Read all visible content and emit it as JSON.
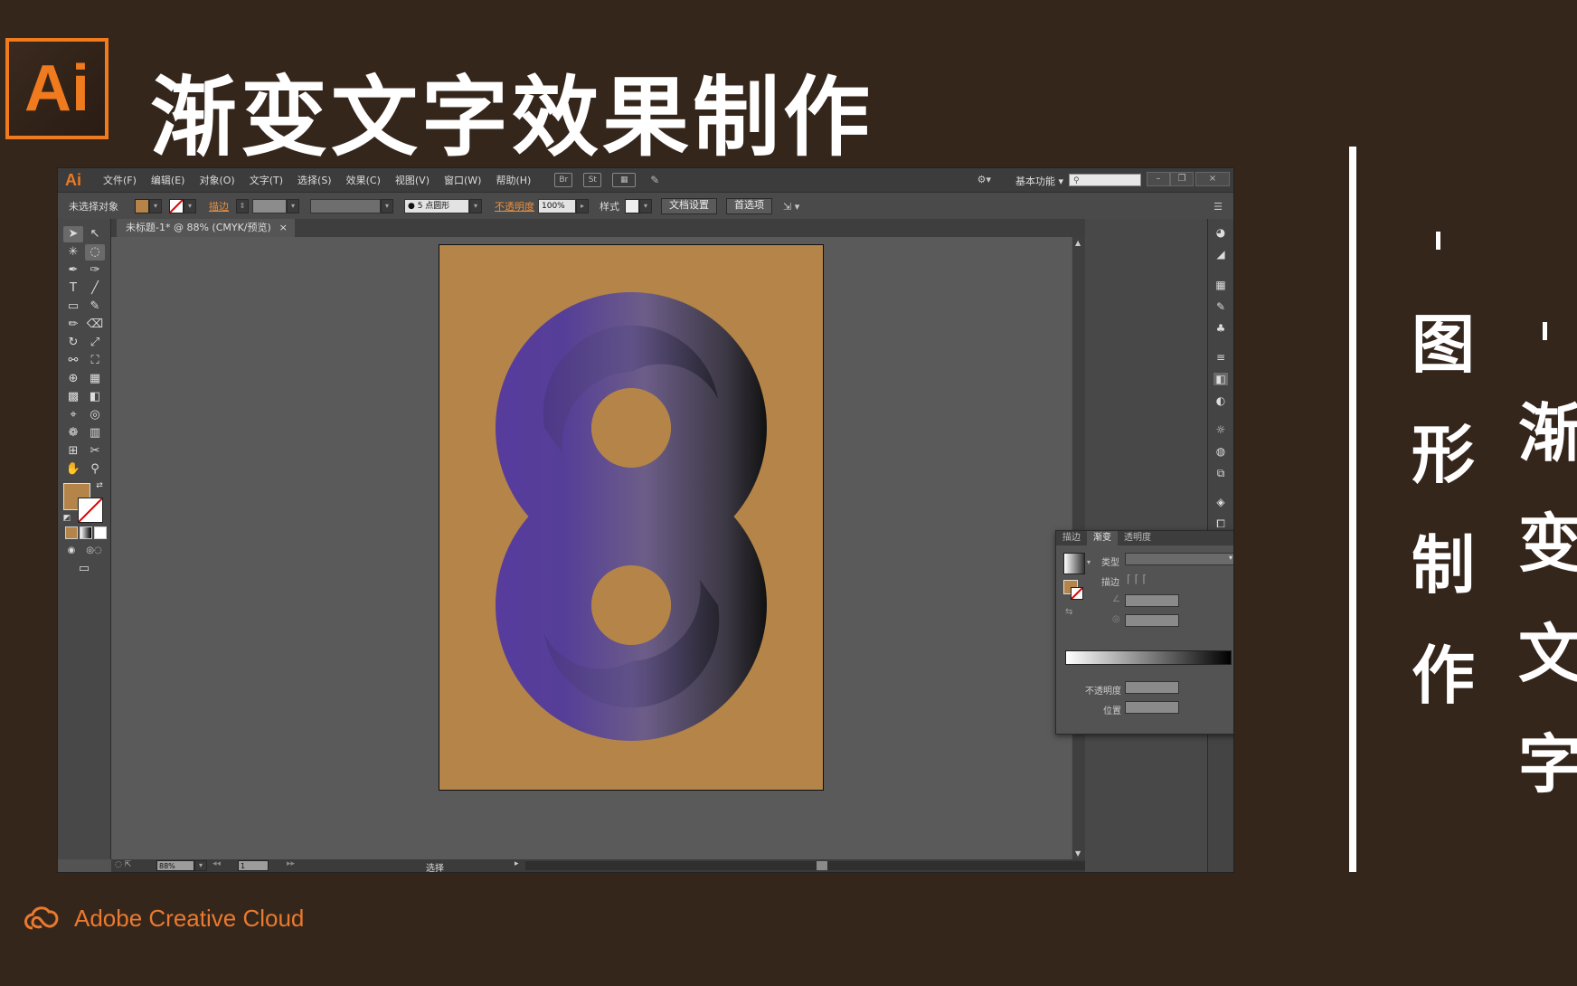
{
  "slide": {
    "logo": "Ai",
    "headline": "渐变文字效果制作",
    "vertical_left": [
      "图",
      "形",
      "制",
      "作"
    ],
    "vertical_right": [
      "渐",
      "变",
      "文",
      "字"
    ],
    "footer_brand": "Adobe Creative Cloud",
    "colors": {
      "background": "#35261c",
      "accent": "#f07a1e"
    }
  },
  "app": {
    "mark": "Ai",
    "menu": [
      "文件(F)",
      "编辑(E)",
      "对象(O)",
      "文字(T)",
      "选择(S)",
      "效果(C)",
      "视图(V)",
      "窗口(W)",
      "帮助(H)"
    ],
    "workspace": "基本功能",
    "menubar_icons": [
      "Br",
      "St"
    ]
  },
  "control_bar": {
    "selection": "未选择对象",
    "stroke_label": "描边",
    "brush": "5 点圆形",
    "opacity_label": "不透明度",
    "opacity_value": "100%",
    "style_label": "样式",
    "doc_setup": "文档设置",
    "preferences": "首选项"
  },
  "document": {
    "tab": "未标题-1* @ 88% (CMYK/预览)",
    "close": "×",
    "zoom": "88%",
    "page": "1",
    "status": "选择",
    "artboard_color": "#b48448"
  },
  "gradient_panel": {
    "tabs": [
      "描边",
      "渐变",
      "透明度"
    ],
    "type_label": "类型",
    "stroke_label": "描边",
    "opacity_label": "不透明度",
    "position_label": "位置"
  }
}
